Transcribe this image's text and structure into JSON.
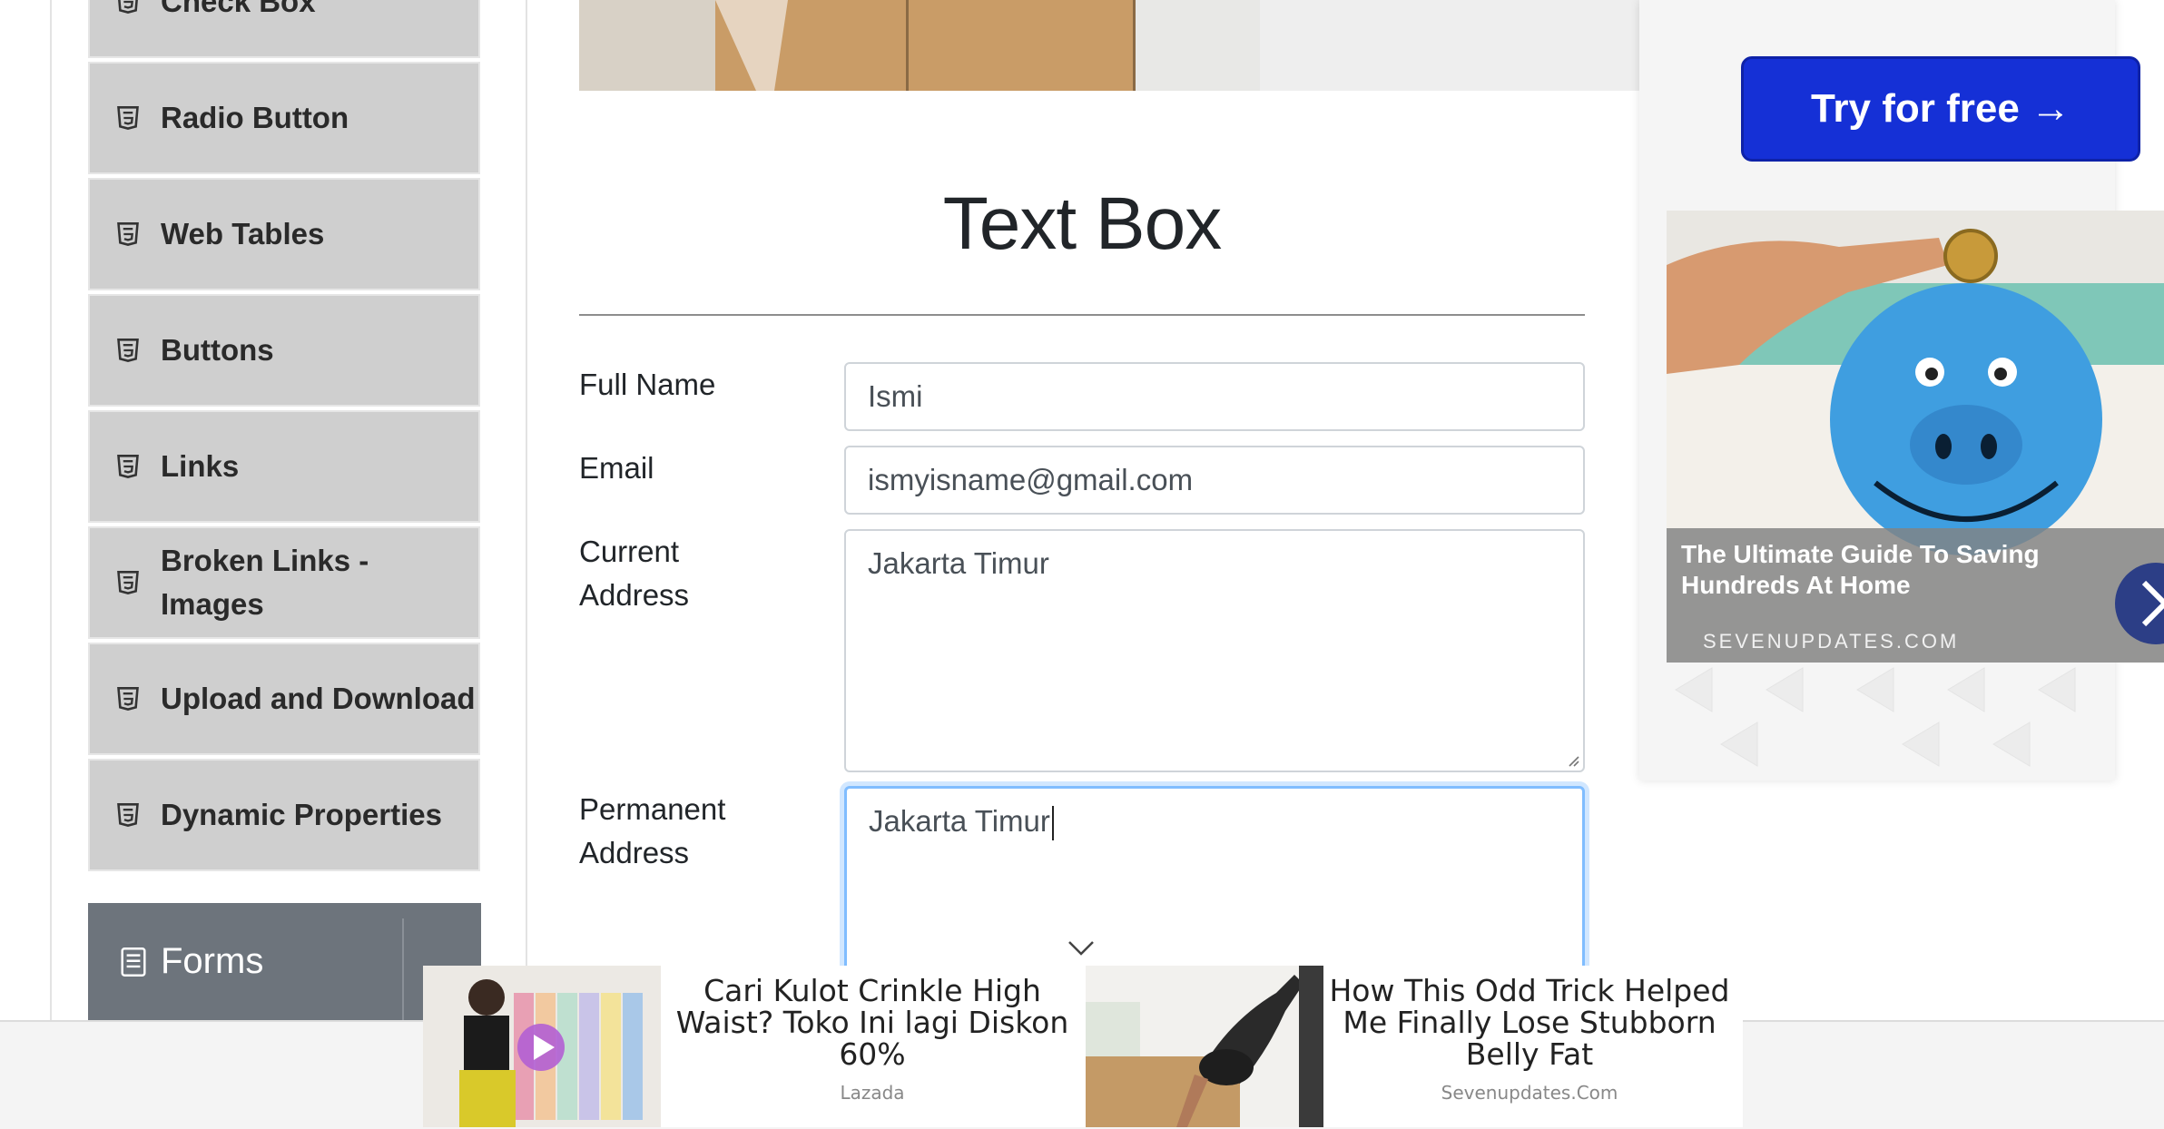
{
  "sidebar": {
    "items": [
      {
        "label": "Check Box"
      },
      {
        "label": "Radio Button"
      },
      {
        "label": "Web Tables"
      },
      {
        "label": "Buttons"
      },
      {
        "label": "Links"
      },
      {
        "label": "Broken Links - Images"
      },
      {
        "label": "Upload and Download"
      },
      {
        "label": "Dynamic Properties"
      }
    ],
    "forms_group": {
      "label": "Forms"
    }
  },
  "main": {
    "title": "Text Box",
    "fields": {
      "full_name": {
        "label": "Full Name",
        "value": "Ismi"
      },
      "email": {
        "label": "Email",
        "value": "ismyisname@gmail.com"
      },
      "current_address": {
        "label": "Current Address",
        "value": "Jakarta Timur"
      },
      "permanent_address": {
        "label": "Permanent Address",
        "value": "Jakarta Timur"
      }
    }
  },
  "side_ad": {
    "button_label": "Try for free →",
    "headline": "The Ultimate Guide To Saving Hundreds At Home",
    "source": "SEVENUPDATES.COM"
  },
  "bottom_ads": [
    {
      "title": "Cari Kulot Crinkle High Waist? Toko Ini lagi Diskon 60%",
      "source": "Lazada"
    },
    {
      "title": "How This Odd Trick Helped Me Finally Lose Stubborn Belly Fat",
      "source": "Sevenupdates.Com"
    }
  ],
  "colors": {
    "menu_bg": "#cfcfcf",
    "forms_header_bg": "#6d747c",
    "focus_border": "#80bdff",
    "ad_button": "#1530d6"
  }
}
